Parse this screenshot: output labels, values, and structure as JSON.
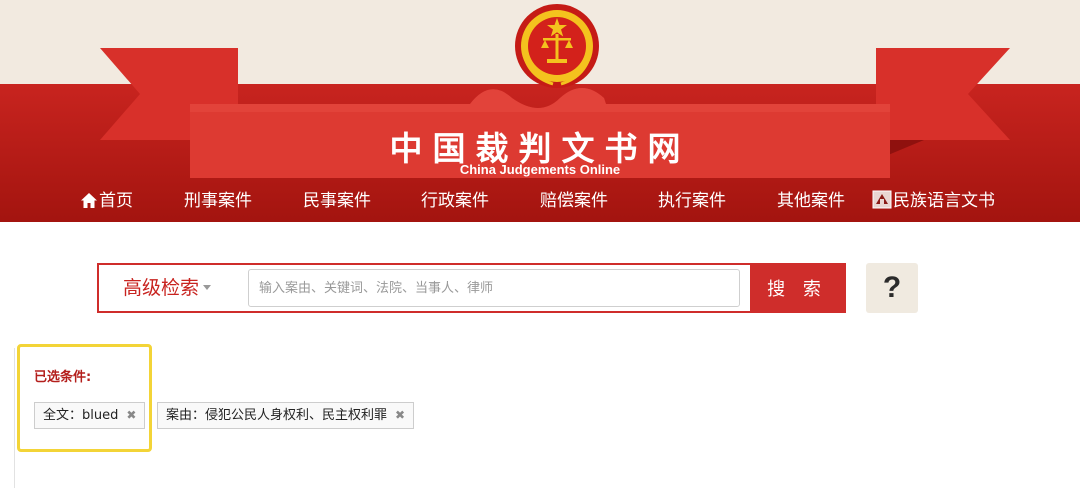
{
  "site": {
    "title": "中国裁判文书网",
    "subtitle": "China Judgements Online"
  },
  "nav": {
    "items": [
      {
        "label": "首页",
        "icon": "home-icon"
      },
      {
        "label": "刑事案件"
      },
      {
        "label": "民事案件"
      },
      {
        "label": "行政案件"
      },
      {
        "label": "赔偿案件"
      },
      {
        "label": "执行案件"
      },
      {
        "label": "其他案件"
      },
      {
        "label": "民族语言文书",
        "icon": "ethnic-language-icon"
      }
    ]
  },
  "search": {
    "advanced_label": "高级检索",
    "placeholder": "输入案由、关键词、法院、当事人、律师",
    "button_label": "搜 索",
    "help_label": "?"
  },
  "filters": {
    "label": "已选条件:",
    "chips": [
      {
        "text": "全文：blued",
        "remove": "✖"
      },
      {
        "text": "案由：侵犯公民人身权利、民主权利罪",
        "remove": "✖"
      }
    ]
  },
  "colors": {
    "brand_red": "#c8241f",
    "cream": "#f2eae0",
    "highlight": "#f3d437"
  }
}
